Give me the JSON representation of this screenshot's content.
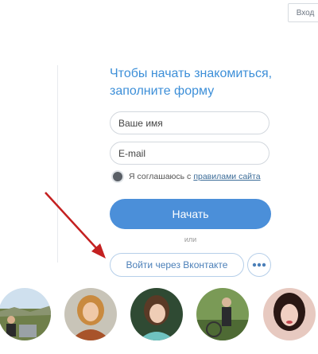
{
  "header": {
    "login_label": "Вход"
  },
  "form": {
    "headline": "Чтобы начать знакомиться, заполните форму",
    "name_placeholder": "Ваше имя",
    "email_placeholder": "E-mail",
    "agree_text": "Я соглашаюсь с",
    "agree_link": "правилами сайта",
    "submit_label": "Начать",
    "or_label": "или",
    "vk_label": "Войти через Вконтакте",
    "more_icon": "more-dots-icon"
  },
  "colors": {
    "accent": "#4b8fd9",
    "headline": "#3d8fd8",
    "annotation_arrow": "#c42020"
  },
  "profiles": [
    {
      "photo": "user-photo-1"
    },
    {
      "photo": "user-photo-2"
    },
    {
      "photo": "user-photo-3"
    },
    {
      "photo": "user-photo-4"
    },
    {
      "photo": "user-photo-5"
    }
  ]
}
